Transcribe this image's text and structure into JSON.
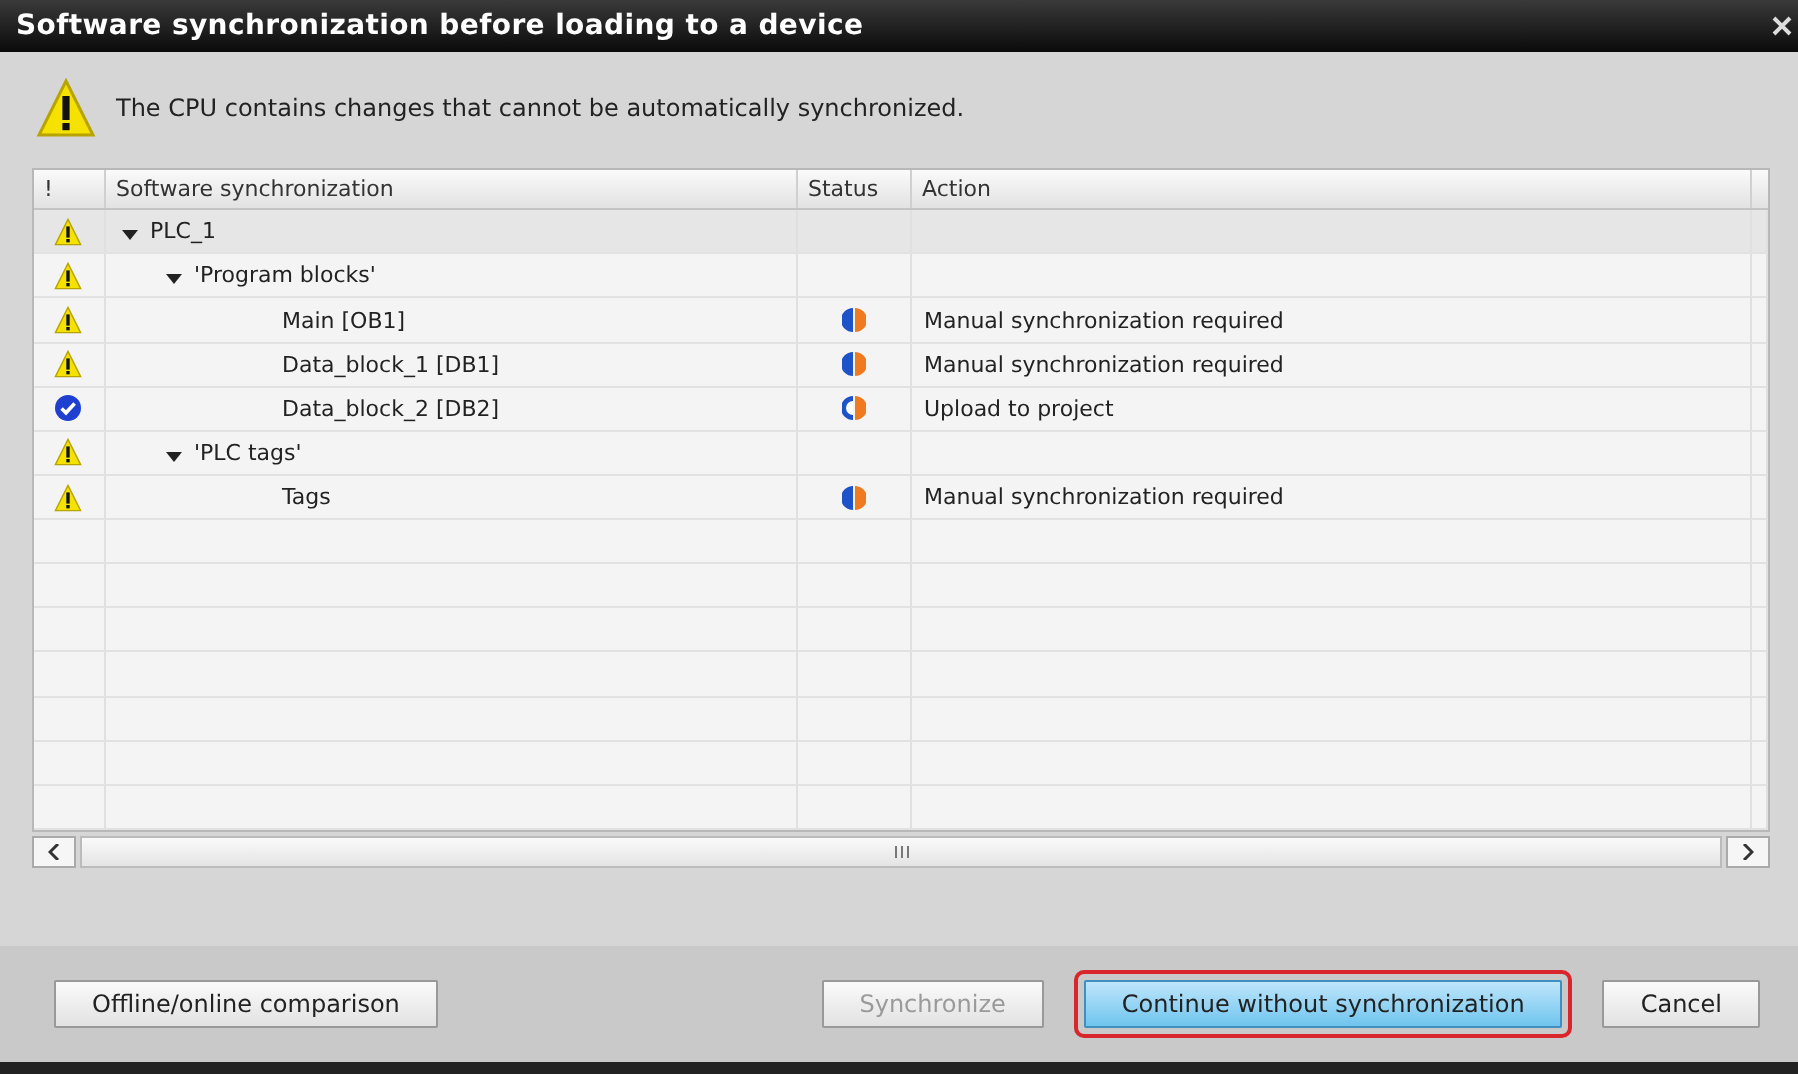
{
  "window": {
    "title": "Software synchronization before loading to a device"
  },
  "message": {
    "text": "The CPU contains changes that cannot be automatically synchronized."
  },
  "table": {
    "columns": [
      "!",
      "Software synchronization",
      "Status",
      "Action"
    ],
    "rows": [
      {
        "warning": true,
        "name": "PLC_1",
        "expanded": true,
        "children": [
          {
            "warning": true,
            "name": "'Program blocks'",
            "expanded": true,
            "children": [
              {
                "warning": true,
                "name": "Main [OB1]",
                "upload": false,
                "action": "Manual synchronization required"
              },
              {
                "warning": true,
                "name": "Data_block_1 [DB1]",
                "upload": false,
                "action": "Manual synchronization required"
              },
              {
                "warning": false,
                "name": "Data_block_2 [DB2]",
                "upload": true,
                "action": "Upload to project"
              }
            ]
          },
          {
            "warning": true,
            "name": "'PLC tags'",
            "expanded": true,
            "children": [
              {
                "warning": true,
                "name": "Tags",
                "upload": false,
                "action": "Manual synchronization required"
              }
            ]
          }
        ]
      }
    ]
  },
  "buttons": [
    {
      "label": "Offline/online comparison",
      "disabled": false,
      "focused": false,
      "highlighted": false
    },
    {
      "label": "Synchronize",
      "disabled": true,
      "focused": false,
      "highlighted": false
    },
    {
      "label": "Continue without synchronization",
      "disabled": false,
      "focused": true,
      "highlighted": true
    },
    {
      "label": "Cancel",
      "disabled": false,
      "focused": false,
      "highlighted": false
    }
  ]
}
